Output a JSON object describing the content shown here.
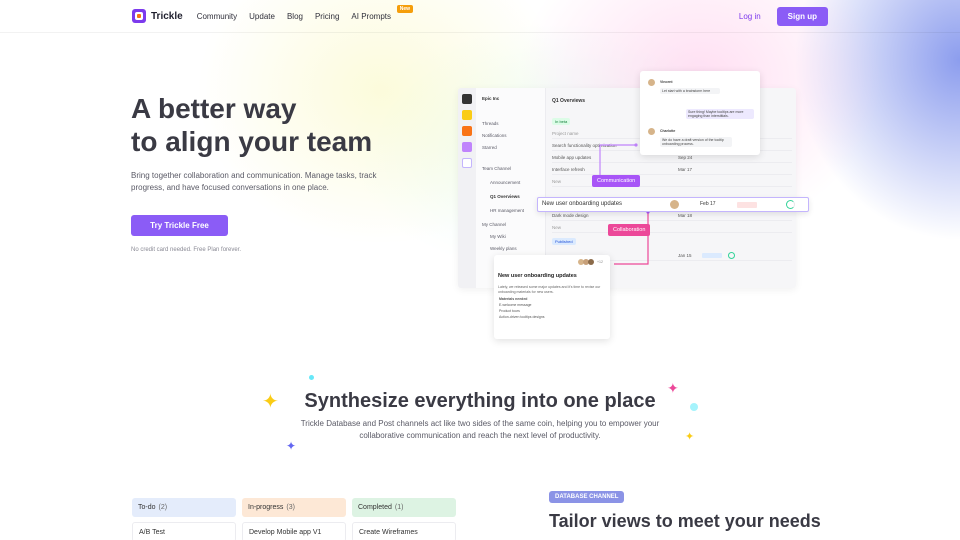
{
  "nav": {
    "brand": "Trickle",
    "links": [
      "Community",
      "Update",
      "Blog",
      "Pricing",
      "AI Prompts"
    ],
    "new_badge": "New",
    "login": "Log in",
    "signup": "Sign up"
  },
  "hero": {
    "title_line1": "A better way",
    "title_line2": "to align your team",
    "subtitle": "Bring together collaboration and communication. Manage tasks, track progress, and have focused conversations in one place.",
    "cta": "Try Trickle Free",
    "note": "No credit card needed. Free Plan forever."
  },
  "mockup": {
    "workspace": "Epic Inc",
    "sidebar": [
      "Threads",
      "Notifications",
      "Starred",
      "Team Channel",
      "Announcement",
      "Q1 Overviews",
      "HR management",
      "My Channel",
      "My Wiki",
      "Weekly plans"
    ],
    "tab": "Q1 Overviews",
    "group_tags": [
      "In beta",
      "Add tool",
      "Published"
    ],
    "rows": [
      "Project name",
      "Search functionality optimization",
      "Mobile app updates",
      "Interface refresh",
      "New",
      "Dark mode design",
      "New"
    ],
    "dates": [
      "Sep 24",
      "Mar 17",
      "Mar 18",
      "Jan 15"
    ],
    "highlight_row": {
      "text": "New user onboarding updates",
      "date": "Feb 17"
    },
    "tag_communication": "Communication",
    "tag_collaboration": "Collaboration",
    "chat": {
      "name1": "Vincent",
      "msg1": "Let start with a brainstorm here",
      "msg2": "Sure thing! Maybe tooltips are more engaging than interstitials.",
      "name2": "Charlotte",
      "msg3": "We do have a draft version of the tooltip onboarding process."
    },
    "post": {
      "count": "+12",
      "title": "New user onboarding updates",
      "body": "Lately, we released some major updates and it's time to revise our onboarding materials for new users.",
      "checklist_title": "Materials needed",
      "checklist": [
        "E-welcome message",
        "Product tours",
        "Action-driven tooltips designs"
      ]
    }
  },
  "section2": {
    "title": "Synthesize everything into one place",
    "subtitle": "Trickle Database and Post channels act like two sides of the same coin, helping you to empower your collaborative communication and reach the next level of productivity."
  },
  "kanban": [
    {
      "label": "To-do",
      "count": "(2)",
      "card": "A/B Test",
      "color": "#e4ecfb"
    },
    {
      "label": "In-progress",
      "count": "(3)",
      "card": "Develop Mobile app V1",
      "color": "#fde8d6"
    },
    {
      "label": "Completed",
      "count": "(1)",
      "card": "Create Wireframes",
      "color": "#ddf3e3"
    }
  ],
  "database": {
    "badge": "DATABASE CHANNEL",
    "title": "Tailor views to meet your needs"
  },
  "colors": {
    "brand": "#8b5cf6",
    "communication_tag": "#a855f7",
    "collaboration_tag": "#ec4899"
  }
}
